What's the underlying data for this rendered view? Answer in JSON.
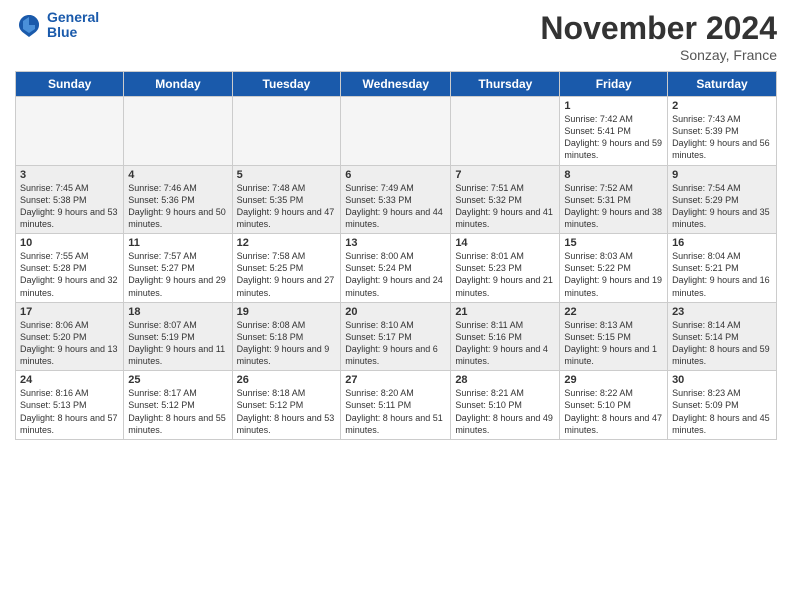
{
  "header": {
    "logo_line1": "General",
    "logo_line2": "Blue",
    "month_title": "November 2024",
    "location": "Sonzay, France"
  },
  "days_of_week": [
    "Sunday",
    "Monday",
    "Tuesday",
    "Wednesday",
    "Thursday",
    "Friday",
    "Saturday"
  ],
  "weeks": [
    {
      "shaded": false,
      "days": [
        {
          "num": "",
          "info": ""
        },
        {
          "num": "",
          "info": ""
        },
        {
          "num": "",
          "info": ""
        },
        {
          "num": "",
          "info": ""
        },
        {
          "num": "",
          "info": ""
        },
        {
          "num": "1",
          "info": "Sunrise: 7:42 AM\nSunset: 5:41 PM\nDaylight: 9 hours and 59 minutes."
        },
        {
          "num": "2",
          "info": "Sunrise: 7:43 AM\nSunset: 5:39 PM\nDaylight: 9 hours and 56 minutes."
        }
      ]
    },
    {
      "shaded": true,
      "days": [
        {
          "num": "3",
          "info": "Sunrise: 7:45 AM\nSunset: 5:38 PM\nDaylight: 9 hours and 53 minutes."
        },
        {
          "num": "4",
          "info": "Sunrise: 7:46 AM\nSunset: 5:36 PM\nDaylight: 9 hours and 50 minutes."
        },
        {
          "num": "5",
          "info": "Sunrise: 7:48 AM\nSunset: 5:35 PM\nDaylight: 9 hours and 47 minutes."
        },
        {
          "num": "6",
          "info": "Sunrise: 7:49 AM\nSunset: 5:33 PM\nDaylight: 9 hours and 44 minutes."
        },
        {
          "num": "7",
          "info": "Sunrise: 7:51 AM\nSunset: 5:32 PM\nDaylight: 9 hours and 41 minutes."
        },
        {
          "num": "8",
          "info": "Sunrise: 7:52 AM\nSunset: 5:31 PM\nDaylight: 9 hours and 38 minutes."
        },
        {
          "num": "9",
          "info": "Sunrise: 7:54 AM\nSunset: 5:29 PM\nDaylight: 9 hours and 35 minutes."
        }
      ]
    },
    {
      "shaded": false,
      "days": [
        {
          "num": "10",
          "info": "Sunrise: 7:55 AM\nSunset: 5:28 PM\nDaylight: 9 hours and 32 minutes."
        },
        {
          "num": "11",
          "info": "Sunrise: 7:57 AM\nSunset: 5:27 PM\nDaylight: 9 hours and 29 minutes."
        },
        {
          "num": "12",
          "info": "Sunrise: 7:58 AM\nSunset: 5:25 PM\nDaylight: 9 hours and 27 minutes."
        },
        {
          "num": "13",
          "info": "Sunrise: 8:00 AM\nSunset: 5:24 PM\nDaylight: 9 hours and 24 minutes."
        },
        {
          "num": "14",
          "info": "Sunrise: 8:01 AM\nSunset: 5:23 PM\nDaylight: 9 hours and 21 minutes."
        },
        {
          "num": "15",
          "info": "Sunrise: 8:03 AM\nSunset: 5:22 PM\nDaylight: 9 hours and 19 minutes."
        },
        {
          "num": "16",
          "info": "Sunrise: 8:04 AM\nSunset: 5:21 PM\nDaylight: 9 hours and 16 minutes."
        }
      ]
    },
    {
      "shaded": true,
      "days": [
        {
          "num": "17",
          "info": "Sunrise: 8:06 AM\nSunset: 5:20 PM\nDaylight: 9 hours and 13 minutes."
        },
        {
          "num": "18",
          "info": "Sunrise: 8:07 AM\nSunset: 5:19 PM\nDaylight: 9 hours and 11 minutes."
        },
        {
          "num": "19",
          "info": "Sunrise: 8:08 AM\nSunset: 5:18 PM\nDaylight: 9 hours and 9 minutes."
        },
        {
          "num": "20",
          "info": "Sunrise: 8:10 AM\nSunset: 5:17 PM\nDaylight: 9 hours and 6 minutes."
        },
        {
          "num": "21",
          "info": "Sunrise: 8:11 AM\nSunset: 5:16 PM\nDaylight: 9 hours and 4 minutes."
        },
        {
          "num": "22",
          "info": "Sunrise: 8:13 AM\nSunset: 5:15 PM\nDaylight: 9 hours and 1 minute."
        },
        {
          "num": "23",
          "info": "Sunrise: 8:14 AM\nSunset: 5:14 PM\nDaylight: 8 hours and 59 minutes."
        }
      ]
    },
    {
      "shaded": false,
      "days": [
        {
          "num": "24",
          "info": "Sunrise: 8:16 AM\nSunset: 5:13 PM\nDaylight: 8 hours and 57 minutes."
        },
        {
          "num": "25",
          "info": "Sunrise: 8:17 AM\nSunset: 5:12 PM\nDaylight: 8 hours and 55 minutes."
        },
        {
          "num": "26",
          "info": "Sunrise: 8:18 AM\nSunset: 5:12 PM\nDaylight: 8 hours and 53 minutes."
        },
        {
          "num": "27",
          "info": "Sunrise: 8:20 AM\nSunset: 5:11 PM\nDaylight: 8 hours and 51 minutes."
        },
        {
          "num": "28",
          "info": "Sunrise: 8:21 AM\nSunset: 5:10 PM\nDaylight: 8 hours and 49 minutes."
        },
        {
          "num": "29",
          "info": "Sunrise: 8:22 AM\nSunset: 5:10 PM\nDaylight: 8 hours and 47 minutes."
        },
        {
          "num": "30",
          "info": "Sunrise: 8:23 AM\nSunset: 5:09 PM\nDaylight: 8 hours and 45 minutes."
        }
      ]
    }
  ]
}
